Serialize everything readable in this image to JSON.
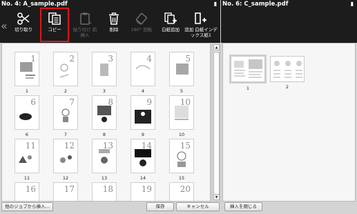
{
  "left": {
    "title": "No. 4: A_sample.pdf",
    "tools": [
      {
        "label": "切り取り",
        "icon": "scissors-icon"
      },
      {
        "label": "コピー",
        "icon": "copy-icon",
        "active": true
      },
      {
        "label": "貼り付け 前挿入",
        "icon": "paste-icon",
        "disabled": true
      },
      {
        "label": "削除",
        "icon": "trash-icon"
      },
      {
        "label": "180° 回転",
        "icon": "rotate-icon",
        "disabled": true
      },
      {
        "label": "白紙追加",
        "icon": "blank-page-add-icon"
      },
      {
        "label": "追加 白紙インデックス紙1",
        "icon": "index-sheet-add-icon"
      }
    ],
    "pages": [
      "1",
      "2",
      "3",
      "4",
      "5",
      "6",
      "7",
      "8",
      "9",
      "10",
      "11",
      "12",
      "13",
      "14",
      "15",
      "16",
      "17",
      "18",
      "19",
      "20"
    ]
  },
  "right": {
    "title": "No. 6: C_sample.pdf",
    "pages": [
      "1",
      "2"
    ]
  },
  "footer": {
    "insert_from_other_job": "他のジョブから挿入...",
    "save": "保存",
    "cancel": "キャンセル",
    "close_insert": "挿入を閉じる"
  }
}
